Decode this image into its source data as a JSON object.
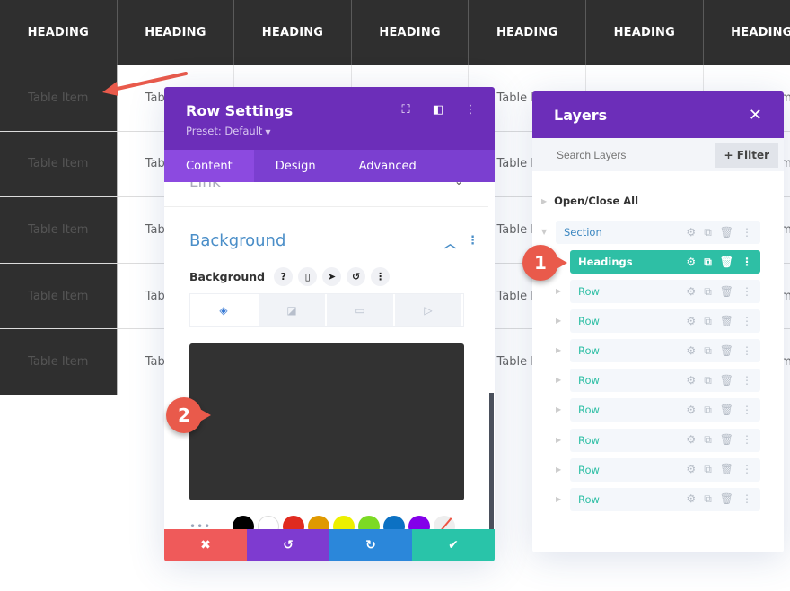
{
  "table": {
    "headers": [
      "HEADING",
      "HEADING",
      "HEADING",
      "HEADING",
      "HEADING",
      "HEADING",
      "HEADING"
    ],
    "rows": [
      [
        "Table Item",
        "Table Item",
        "",
        "",
        "Table Item",
        "",
        "Table Item"
      ],
      [
        "Table Item",
        "Table Item",
        "",
        "",
        "Table Item",
        "",
        "Table Item"
      ],
      [
        "Table Item",
        "Table Item",
        "",
        "",
        "Table Item",
        "",
        "Table Item"
      ],
      [
        "Table Item",
        "Table Item",
        "",
        "",
        "Table Item",
        "",
        "Table Item"
      ],
      [
        "Table Item",
        "Table Item",
        "",
        "",
        "Table Item",
        "",
        "Table Item"
      ]
    ]
  },
  "row_settings": {
    "title": "Row Settings",
    "preset": "Preset: Default",
    "header_icons": [
      "fullscreen-icon",
      "sidebar-layout-icon",
      "more-options-icon"
    ],
    "tabs": [
      {
        "label": "Content",
        "active": true
      },
      {
        "label": "Design",
        "active": false
      },
      {
        "label": "Advanced",
        "active": false
      }
    ],
    "collapsed_section": "Link",
    "section_title": "Background",
    "field_label": "Background",
    "field_icons": [
      "help-icon",
      "mobile-icon",
      "hover-cursor-icon",
      "reset-icon",
      "more-icon"
    ],
    "background_types": [
      {
        "name": "color",
        "active": true
      },
      {
        "name": "gradient",
        "active": false
      },
      {
        "name": "image",
        "active": false
      },
      {
        "name": "video",
        "active": false
      }
    ],
    "preview_color": "#323232",
    "swatches": [
      "#000000",
      "#ffffff",
      "#e02b20",
      "#e09900",
      "#edf000",
      "#7cda24",
      "#0c71c3",
      "#8300e9",
      "none"
    ],
    "footer": [
      {
        "name": "cancel",
        "glyph": "✖",
        "color": "#ef5a5a"
      },
      {
        "name": "undo",
        "glyph": "↺",
        "color": "#7e3bd0"
      },
      {
        "name": "redo",
        "glyph": "↻",
        "color": "#2b87da"
      },
      {
        "name": "save",
        "glyph": "✔",
        "color": "#29c4a9"
      }
    ]
  },
  "layers": {
    "title": "Layers",
    "search_placeholder": "Search Layers",
    "filter_label": "+ Filter",
    "open_close_all": "Open/Close All",
    "section": "Section",
    "selected": "Headings",
    "rows": [
      "Row",
      "Row",
      "Row",
      "Row",
      "Row",
      "Row",
      "Row",
      "Row"
    ]
  },
  "annotations": {
    "badge1": "1",
    "badge2": "2"
  },
  "colors": {
    "purple": "#6c2eb9",
    "teal": "#2ebfa5",
    "accent_blue": "#4a8ec8",
    "badge_red": "#e95a4b"
  }
}
